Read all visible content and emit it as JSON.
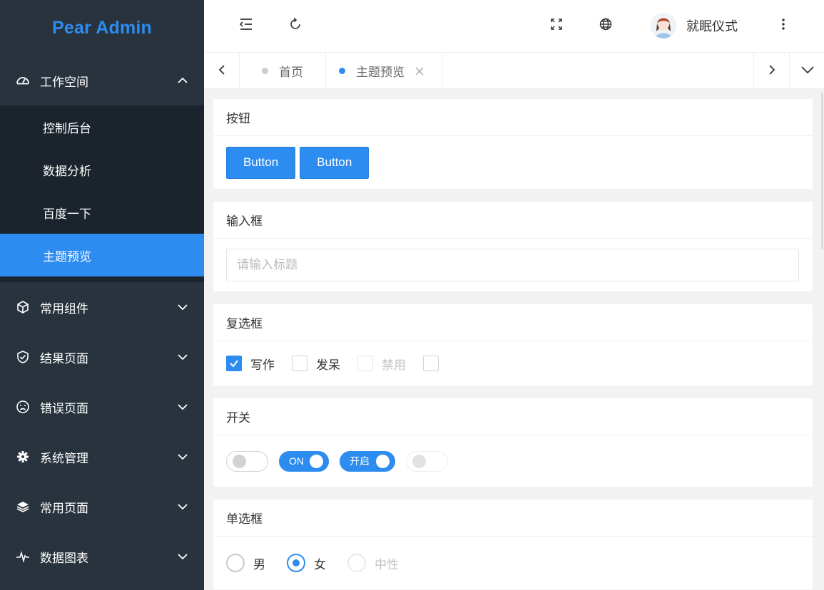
{
  "app": {
    "title": "Pear Admin"
  },
  "sidebar": {
    "workspace": {
      "label": "工作空间",
      "icon": "dashboard-icon"
    },
    "submenu": [
      {
        "label": "控制后台"
      },
      {
        "label": "数据分析"
      },
      {
        "label": "百度一下"
      },
      {
        "label": "主题预览",
        "active": true
      }
    ],
    "items": [
      {
        "label": "常用组件",
        "icon": "box-icon"
      },
      {
        "label": "结果页面",
        "icon": "shield-check-icon"
      },
      {
        "label": "错误页面",
        "icon": "sad-face-icon"
      },
      {
        "label": "系统管理",
        "icon": "gear-icon"
      },
      {
        "label": "常用页面",
        "icon": "layers-icon"
      },
      {
        "label": "数据图表",
        "icon": "pulse-icon"
      }
    ]
  },
  "header": {
    "user_name": "就眠仪式",
    "icons": [
      "menu-fold-icon",
      "refresh-icon",
      "fullscreen-icon",
      "globe-icon",
      "more-vertical-icon"
    ]
  },
  "tabs": [
    {
      "label": "首页",
      "active": false
    },
    {
      "label": "主题预览",
      "active": true
    }
  ],
  "cards": {
    "button": {
      "title": "按钮",
      "buttons": [
        "Button",
        "Button"
      ]
    },
    "input": {
      "title": "输入框",
      "placeholder": "请输入标题",
      "value": ""
    },
    "checkbox": {
      "title": "复选框",
      "items": [
        {
          "label": "写作",
          "checked": true,
          "disabled": false
        },
        {
          "label": "发呆",
          "checked": false,
          "disabled": false
        },
        {
          "label": "禁用",
          "checked": false,
          "disabled": true
        },
        {
          "label": "",
          "checked": false,
          "disabled": false
        }
      ]
    },
    "switch": {
      "title": "开关",
      "items": [
        {
          "text": "",
          "on": false,
          "disabled": false
        },
        {
          "text": "ON",
          "on": true,
          "disabled": false
        },
        {
          "text": "开启",
          "on": true,
          "disabled": false
        },
        {
          "text": "",
          "on": false,
          "disabled": true
        }
      ]
    },
    "radio": {
      "title": "单选框",
      "items": [
        {
          "label": "男",
          "checked": false,
          "disabled": false
        },
        {
          "label": "女",
          "checked": true,
          "disabled": false
        },
        {
          "label": "中性",
          "checked": false,
          "disabled": true
        }
      ]
    }
  },
  "colors": {
    "accent": "#2d8cf0",
    "sidebar_bg": "#28333e",
    "submenu_bg": "#1b232c",
    "logo": "#2d8cf0"
  }
}
